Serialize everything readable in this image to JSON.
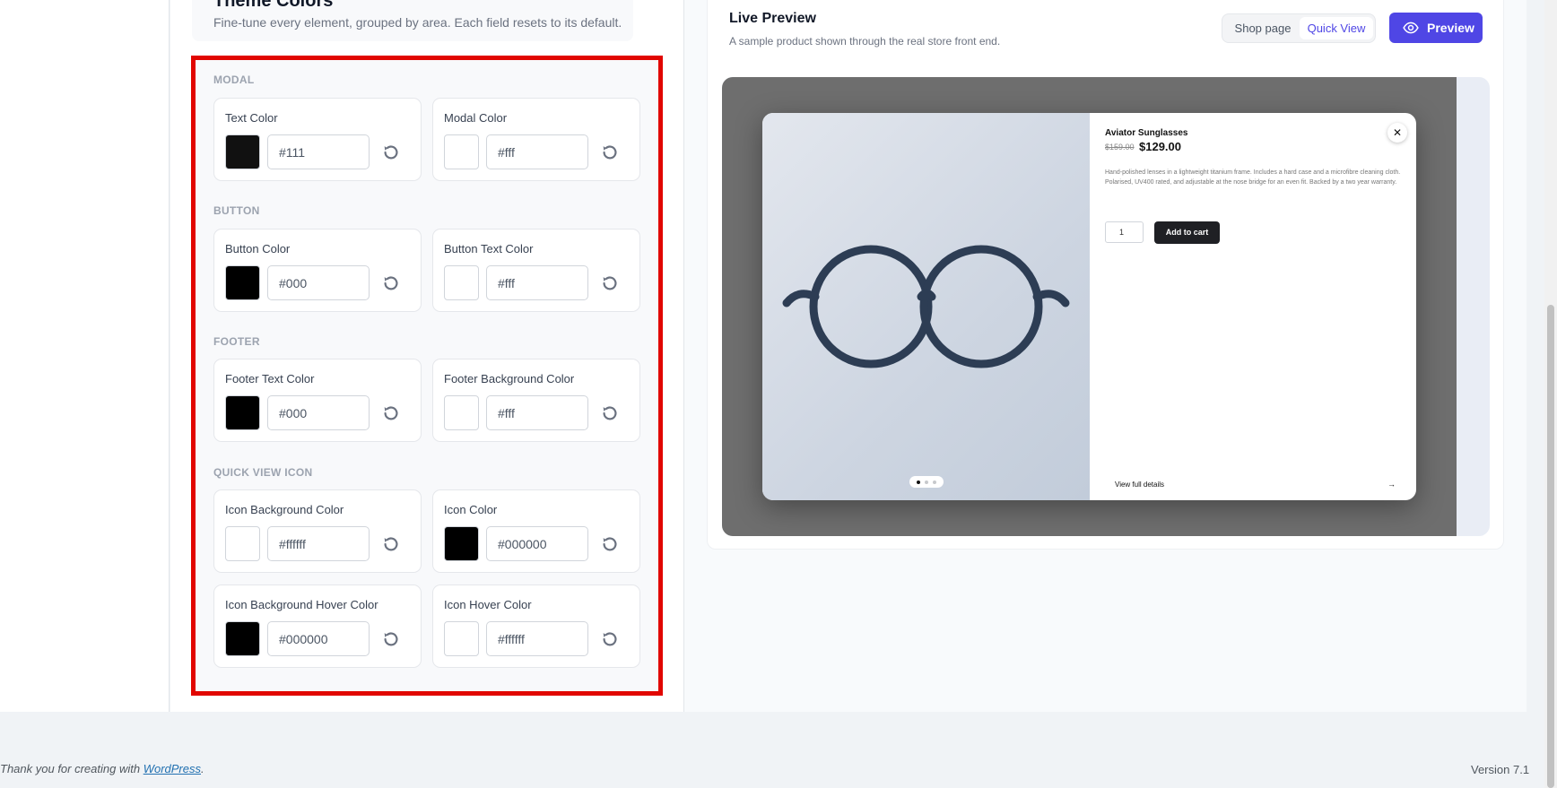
{
  "section": {
    "title": "Theme Colors",
    "subtitle": "Fine-tune every element, grouped by area. Each field resets to its default."
  },
  "groups": {
    "modal": {
      "label": "MODAL",
      "fields": [
        {
          "label": "Text Color",
          "value": "#111",
          "swatch": "#111111"
        },
        {
          "label": "Modal Color",
          "value": "#fff",
          "swatch": "#ffffff"
        }
      ]
    },
    "button": {
      "label": "BUTTON",
      "fields": [
        {
          "label": "Button Color",
          "value": "#000",
          "swatch": "#000000"
        },
        {
          "label": "Button Text Color",
          "value": "#fff",
          "swatch": "#ffffff"
        }
      ]
    },
    "footer": {
      "label": "FOOTER",
      "fields": [
        {
          "label": "Footer Text Color",
          "value": "#000",
          "swatch": "#000000"
        },
        {
          "label": "Footer Background Color",
          "value": "#fff",
          "swatch": "#ffffff"
        }
      ]
    },
    "quickview": {
      "label": "QUICK VIEW ICON",
      "fields": [
        {
          "label": "Icon Background Color",
          "value": "#ffffff",
          "swatch": "#ffffff"
        },
        {
          "label": "Icon Color",
          "value": "#000000",
          "swatch": "#000000"
        },
        {
          "label": "Icon Background Hover Color",
          "value": "#000000",
          "swatch": "#000000"
        },
        {
          "label": "Icon Hover Color",
          "value": "#ffffff",
          "swatch": "#ffffff"
        }
      ]
    }
  },
  "preview": {
    "title": "Live Preview",
    "subtitle": "A sample product shown through the real store front end.",
    "toggle": {
      "shop": "Shop page",
      "quick": "Quick View",
      "active": "quick"
    },
    "button_label": "Preview",
    "product": {
      "name": "Aviator Sunglasses",
      "old_price": "$159.00",
      "price": "$129.00",
      "description_1": "Hand-polished lenses in a lightweight titanium frame. Includes a hard case and a microfibre cleaning cloth.",
      "description_2": "Polarised, UV400 rated, and adjustable at the nose bridge for an even fit. Backed by a two year warranty.",
      "qty": "1",
      "add_to_cart": "Add to cart",
      "view_full": "View full details",
      "view_arrow": "→",
      "close": "✕"
    }
  },
  "footer": {
    "thank_prefix": "Thank you for creating with ",
    "link": "WordPress",
    "suffix": ".",
    "version": "Version 7.1"
  },
  "colors": {
    "accent": "#4f46e5",
    "highlight": "#e10600",
    "glasses": "#2d3d54"
  }
}
